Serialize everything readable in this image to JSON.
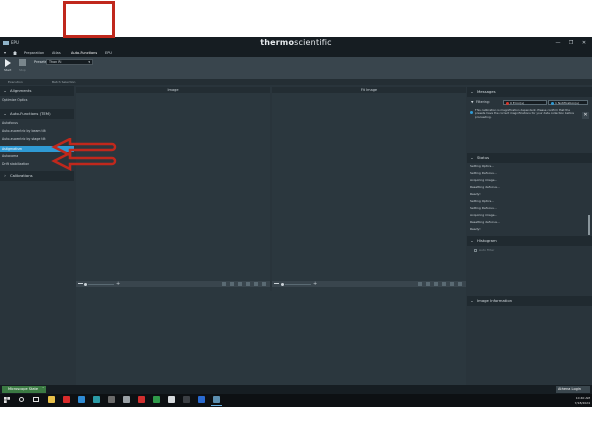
{
  "app": {
    "name": "EPU",
    "brand_prefix": "thermo",
    "brand_suffix": "scientific",
    "window_buttons": [
      "—",
      "❐",
      "✕"
    ]
  },
  "menu": {
    "items": [
      "Preparation",
      "Atlas",
      "Auto-Functions",
      "EPU"
    ]
  },
  "ribbon": {
    "start_label": "Start",
    "stop_label": "Stop",
    "presets_label": "Presets:",
    "presets_value": "Thon Ri"
  },
  "panel_headers": {
    "left": "Execution",
    "right": "Batch Selection"
  },
  "left_panel": {
    "alignments": {
      "title": "Alignments",
      "items": [
        "Optimize Optics"
      ]
    },
    "auto_functions": {
      "title": "Auto-Functions (TEM)",
      "items": [
        "Autofocus",
        "Auto-eucentric by beam tilt",
        "Auto-eucentric by stage tilt",
        "Astigmatism",
        "Autocoma",
        "Drift stabilization"
      ],
      "selected": "Astigmatism"
    },
    "calibrations": {
      "title": "Calibrations"
    }
  },
  "image_panels": {
    "image": {
      "title": "Image"
    },
    "fit_image": {
      "title": "Fit Image"
    }
  },
  "right_panel": {
    "messages": {
      "title": "Messages",
      "filtering_label": "Filtering:",
      "errors": "0 Error(s)",
      "notifications": "1 Notification(s)",
      "notification_text": "This calibration is magnification dependent. Please confirm that the presets have the correct magnifications for your data collection before proceeding."
    },
    "status": {
      "title": "Status",
      "lines": [
        "Setting Optics...",
        "Setting Defocus...",
        "Acquiring image...",
        "Resetting defocus...",
        "Ready!",
        "Setting Optics...",
        "Setting Defocus...",
        "Acquiring image...",
        "Resetting defocus...",
        "Ready!"
      ]
    },
    "histogram": {
      "title": "Histogram",
      "auto_filter": "Auto Filter"
    },
    "image_information": {
      "title": "Image Information"
    }
  },
  "status_bar": {
    "microscope_state": "Microscope State",
    "user": "Athena Login"
  },
  "taskbar": {
    "time": "10:40 AM",
    "date": "7/18/2024"
  },
  "colors": {
    "highlight": "#c0281c",
    "selection": "#2f9ad4",
    "microscope_state": "#3b7a43"
  }
}
